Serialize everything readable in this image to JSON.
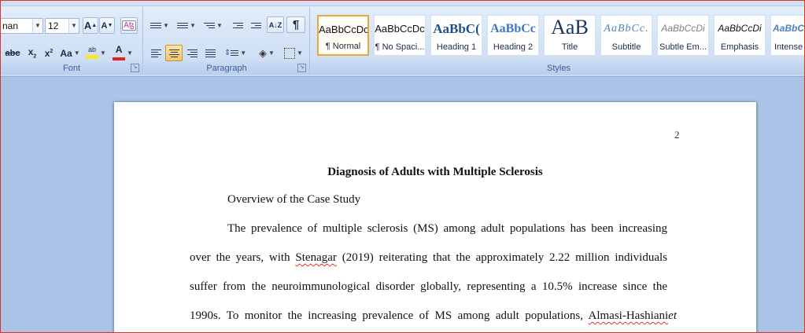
{
  "ribbon": {
    "font": {
      "label": "Font",
      "font_name": "nan",
      "font_size": "12",
      "grow_label": "A",
      "shrink_label": "A",
      "strike_label": "abc",
      "subscript_label": "x",
      "superscript_label": "x",
      "change_case_label": "Aa",
      "highlight_label": "ab",
      "font_color_label": "A",
      "highlight_color": "#f7e82a",
      "font_color": "#e0231b"
    },
    "paragraph": {
      "label": "Paragraph",
      "sort_label": "A↓Z",
      "show_marks_label": "¶"
    },
    "styles": {
      "label": "Styles",
      "items": [
        {
          "sample": "AaBbCcDc",
          "name": "¶ Normal"
        },
        {
          "sample": "AaBbCcDc",
          "name": "¶ No Spaci..."
        },
        {
          "sample": "AaBbC(",
          "name": "Heading 1"
        },
        {
          "sample": "AaBbCc",
          "name": "Heading 2"
        },
        {
          "sample": "AaB",
          "name": "Title"
        },
        {
          "sample": "AaBbCc.",
          "name": "Subtitle"
        },
        {
          "sample": "AaBbCcDi",
          "name": "Subtle Em..."
        },
        {
          "sample": "AaBbCcDi",
          "name": "Emphasis"
        },
        {
          "sample": "AaBbCcDi",
          "name": "Intense"
        }
      ]
    }
  },
  "document": {
    "page_number": "2",
    "title": "Diagnosis of Adults with Multiple Sclerosis",
    "heading": "Overview of the Case Study",
    "lines": [
      "The prevalence of multiple sclerosis (MS) among adult populations has been increasing",
      [
        "over the years, with ",
        "Stenagar",
        " (2019) reiterating that the approximately 2.22 million individuals"
      ],
      "suffer from the neuroimmunological disorder globally, representing a 10.5% increase since the",
      [
        "1990s. To monitor the increasing prevalence of MS among adult populations, ",
        "Almasi-Hashiani",
        "et"
      ]
    ]
  }
}
